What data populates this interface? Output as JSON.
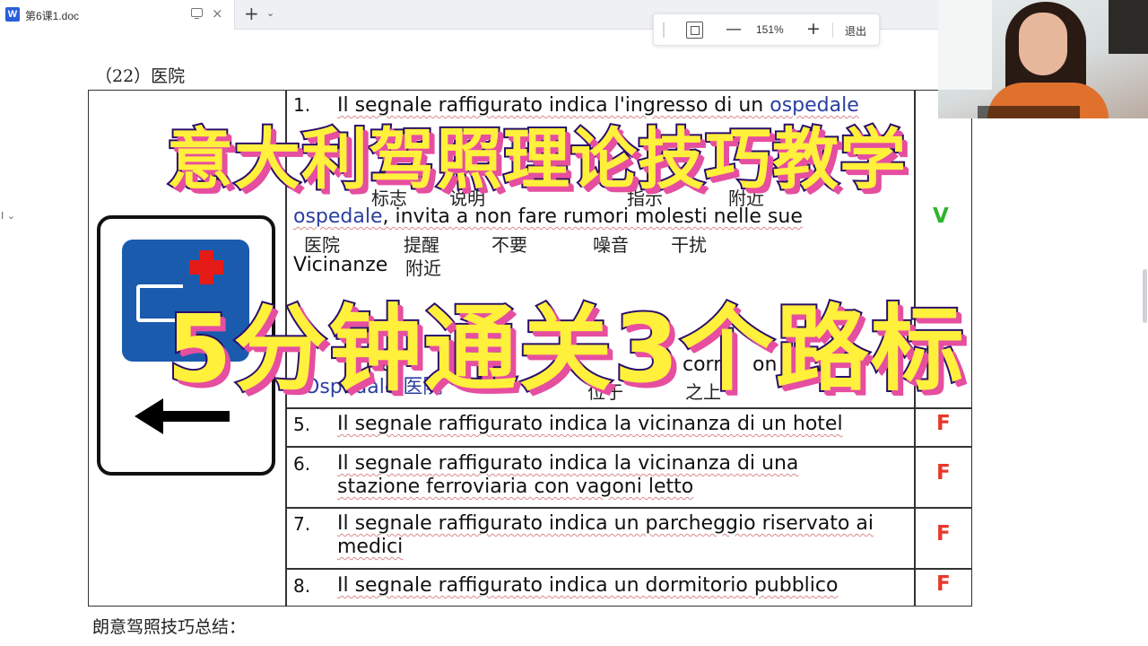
{
  "tab": {
    "app_letter": "W",
    "title": "第6课1.doc",
    "close": "×",
    "add": "+",
    "more": "⌄"
  },
  "zoom": {
    "level": "151%",
    "exit_label": "退出",
    "minus": "—",
    "plus": "+"
  },
  "document": {
    "section_label": "（22）医院",
    "summary_label": "朗意驾照技巧总结：",
    "rows": [
      {
        "num": "1.",
        "text_a": "Il segnale raffigurato indica l'ingresso di un ",
        "text_b": "ospedale",
        "mark": ""
      },
      {
        "gloss_line": [
          "标志",
          "说明",
          "指示",
          "附近"
        ]
      },
      {
        "text_a": "ospedale",
        "text_b": ", invita a non fare rumori molesti nelle sue",
        "mark": "V"
      },
      {
        "gloss_line2": [
          "医院",
          "提醒",
          "不要",
          "噪音",
          "干扰"
        ]
      },
      {
        "text": "Vicinanze",
        "gloss": "附近"
      },
      {
        "partial": [
          "a",
          "corr",
          "on"
        ]
      },
      {
        "ospedale": "Ospedale",
        "gloss": "医院",
        "gloss_b": "位于",
        "gloss_c": "之上"
      },
      {
        "num": "5.",
        "text": "Il segnale raffigurato indica la vicinanza di un hotel",
        "mark": "F"
      },
      {
        "num": "6.",
        "text": "Il segnale raffigurato indica la vicinanza di una",
        "text2": "stazione ferroviaria con vagoni letto",
        "mark": "F"
      },
      {
        "num": "7.",
        "text": "Il segnale raffigurato indica un parcheggio riservato ai",
        "text2": "medici",
        "mark": "F"
      },
      {
        "num": "8.",
        "text": "Il segnale raffigurato indica un dormitorio pubblico",
        "mark": "F"
      }
    ]
  },
  "overlay": {
    "line1": "意大利驾照理论技巧教学",
    "line2": "5分钟通关3个路标"
  },
  "colors": {
    "true_mark": "#2db52d",
    "false_mark": "#e8372a",
    "overlay_fill": "#fff03c",
    "sign_blue": "#1a5bae"
  },
  "icons": {
    "sign": "hospital-sign-icon",
    "arrow": "left-arrow-icon"
  }
}
